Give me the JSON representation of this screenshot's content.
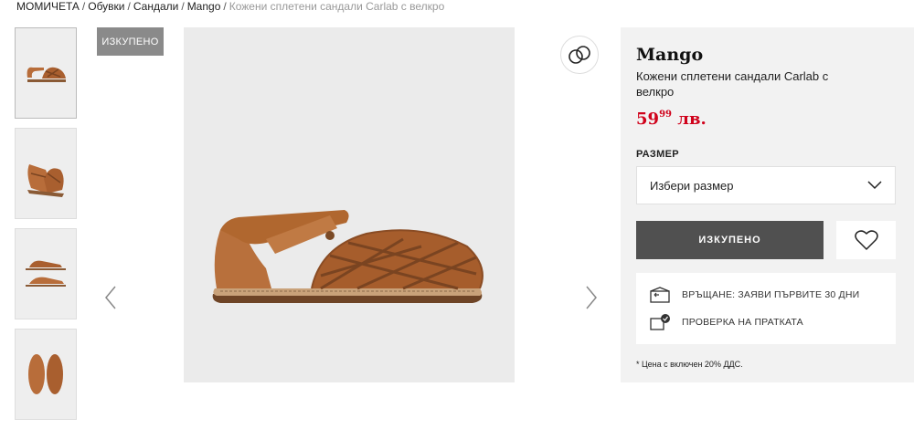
{
  "breadcrumb": {
    "items": [
      "МОМИЧЕТА",
      "Обувки",
      "Сандали",
      "Mango"
    ],
    "current": "Кожени сплетени сандали Carlab с велкро",
    "separator": "/"
  },
  "gallery": {
    "badge": "ИЗКУПЕНО",
    "thumbnail_count": 4
  },
  "product": {
    "brand": "Mango",
    "name": "Кожени сплетени сандали Carlab с велкро",
    "price_main": "59",
    "price_cents": "99",
    "currency": "лв.",
    "price_color": "#d0021b"
  },
  "size": {
    "label": "РАЗМЕР",
    "selected": "Избери размер"
  },
  "actions": {
    "soldout_label": "ИЗКУПЕНО"
  },
  "info": {
    "returns": "ВРЪЩАНЕ: ЗАЯВИ ПЪРВИТЕ 30 ДНИ",
    "tracking": "ПРОВЕРКА НА ПРАТКАТА"
  },
  "note": "* Цена с включен 20% ДДС.",
  "icons": [
    "compare-icon",
    "chevron-left-icon",
    "chevron-right-icon",
    "chevron-down-icon",
    "heart-icon",
    "return-box-icon",
    "tracking-box-icon"
  ]
}
